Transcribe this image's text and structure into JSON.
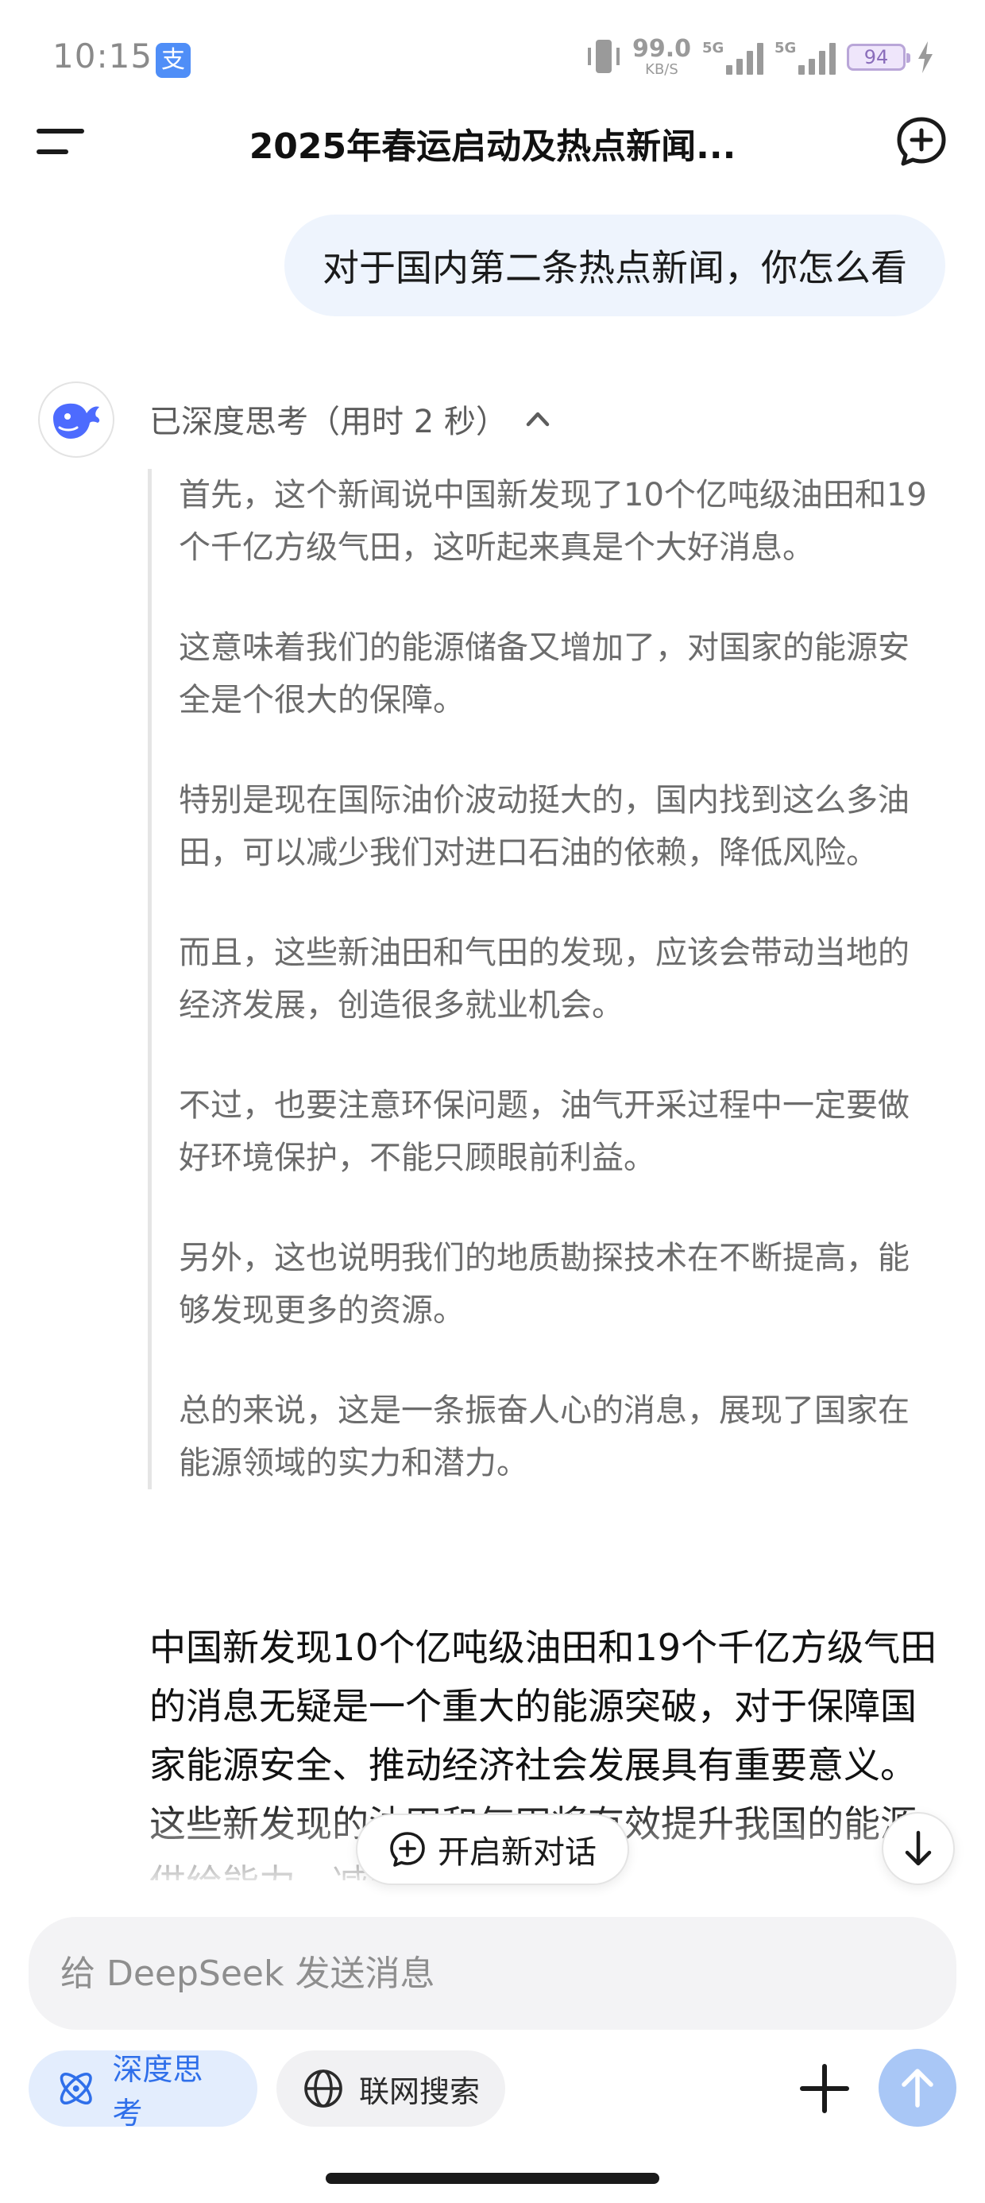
{
  "status_bar": {
    "time": "10:15",
    "app_icon_glyph": "支",
    "net_speed_value": "99.0",
    "net_speed_unit": "KB/S",
    "signal_1_tag": "5G",
    "signal_2_tag": "5G",
    "battery_level": "94"
  },
  "header": {
    "title": "2025年春运启动及热点新闻..."
  },
  "user_message": "对于国内第二条热点新闻，你怎么看",
  "assistant": {
    "think_label": "已深度思考（用时 2 秒）",
    "think_paragraphs": [
      "首先，这个新闻说中国新发现了10个亿吨级油田和19个千亿方级气田，这听起来真是个大好消息。",
      "这意味着我们的能源储备又增加了，对国家的能源安全是个很大的保障。",
      "特别是现在国际油价波动挺大的，国内找到这么多油田，可以减少我们对进口石油的依赖，降低风险。",
      "而且，这些新油田和气田的发现，应该会带动当地的经济发展，创造很多就业机会。",
      "不过，也要注意环保问题，油气开采过程中一定要做好环境保护，不能只顾眼前利益。",
      "另外，这也说明我们的地质勘探技术在不断提高，能够发现更多的资源。",
      "总的来说，这是一条振奋人心的消息，展现了国家在能源领域的实力和潜力。"
    ],
    "answer_text": "中国新发现10个亿吨级油田和19个千亿方级气田的消息无疑是一个重大的能源突破，对于保障国家能源安全、推动经济社会发展具有重要意义。这些新发现的油田和气田将有效提升我国的能源供给能力，减少对进口"
  },
  "floating": {
    "new_chat_label": "开启新对话"
  },
  "composer": {
    "placeholder": "给 DeepSeek 发送消息",
    "deep_think_label": "深度思考",
    "web_search_label": "联网搜索"
  },
  "colors": {
    "accent": "#2f6fea",
    "send_disabled": "#a9c7f6",
    "bubble": "#eef4fd"
  }
}
